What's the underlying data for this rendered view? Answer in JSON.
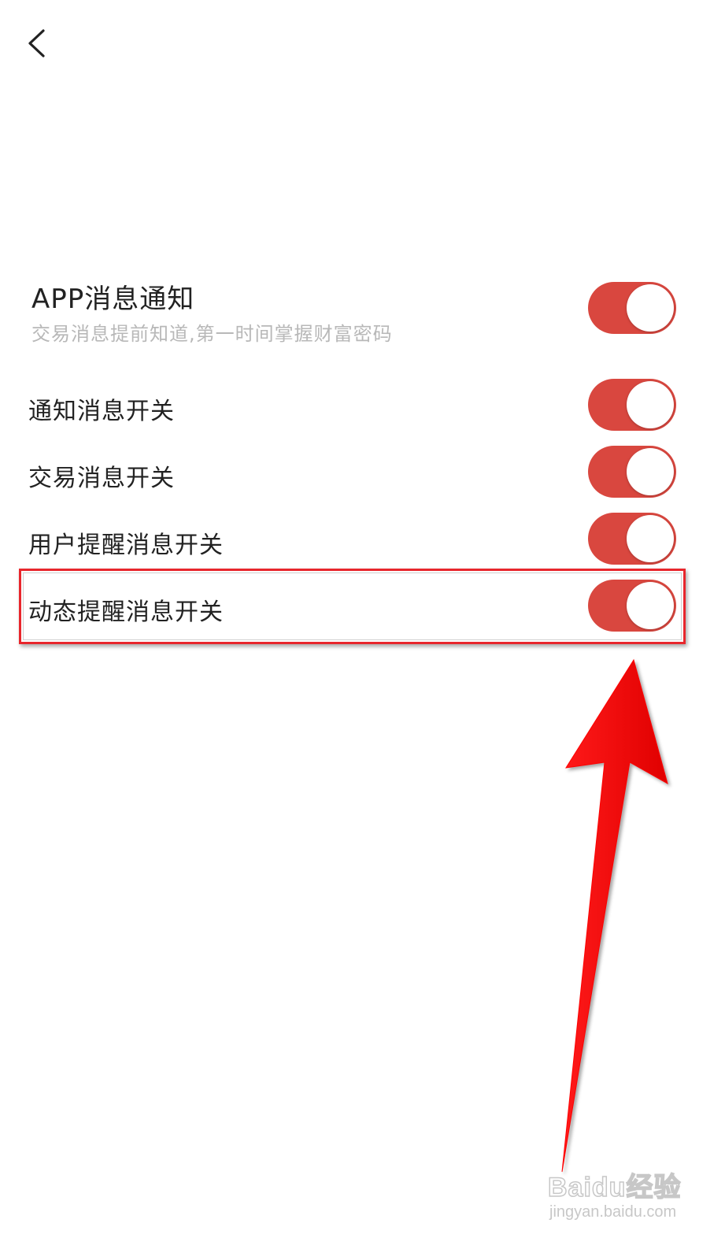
{
  "header": {
    "back_icon": "chevron-left-icon"
  },
  "app_notification": {
    "title": "APP消息通知",
    "subtitle": "交易消息提前知道,第一时间掌握财富密码",
    "enabled": true
  },
  "switches": [
    {
      "label": "通知消息开关",
      "enabled": true
    },
    {
      "label": "交易消息开关",
      "enabled": true
    },
    {
      "label": "用户提醒消息开关",
      "enabled": true
    },
    {
      "label": "动态提醒消息开关",
      "enabled": true
    }
  ],
  "colors": {
    "toggle_on": "#d9473f",
    "annotation": "#ff0000"
  },
  "watermark": {
    "brand": "Baidu经验",
    "url": "jingyan.baidu.com"
  }
}
